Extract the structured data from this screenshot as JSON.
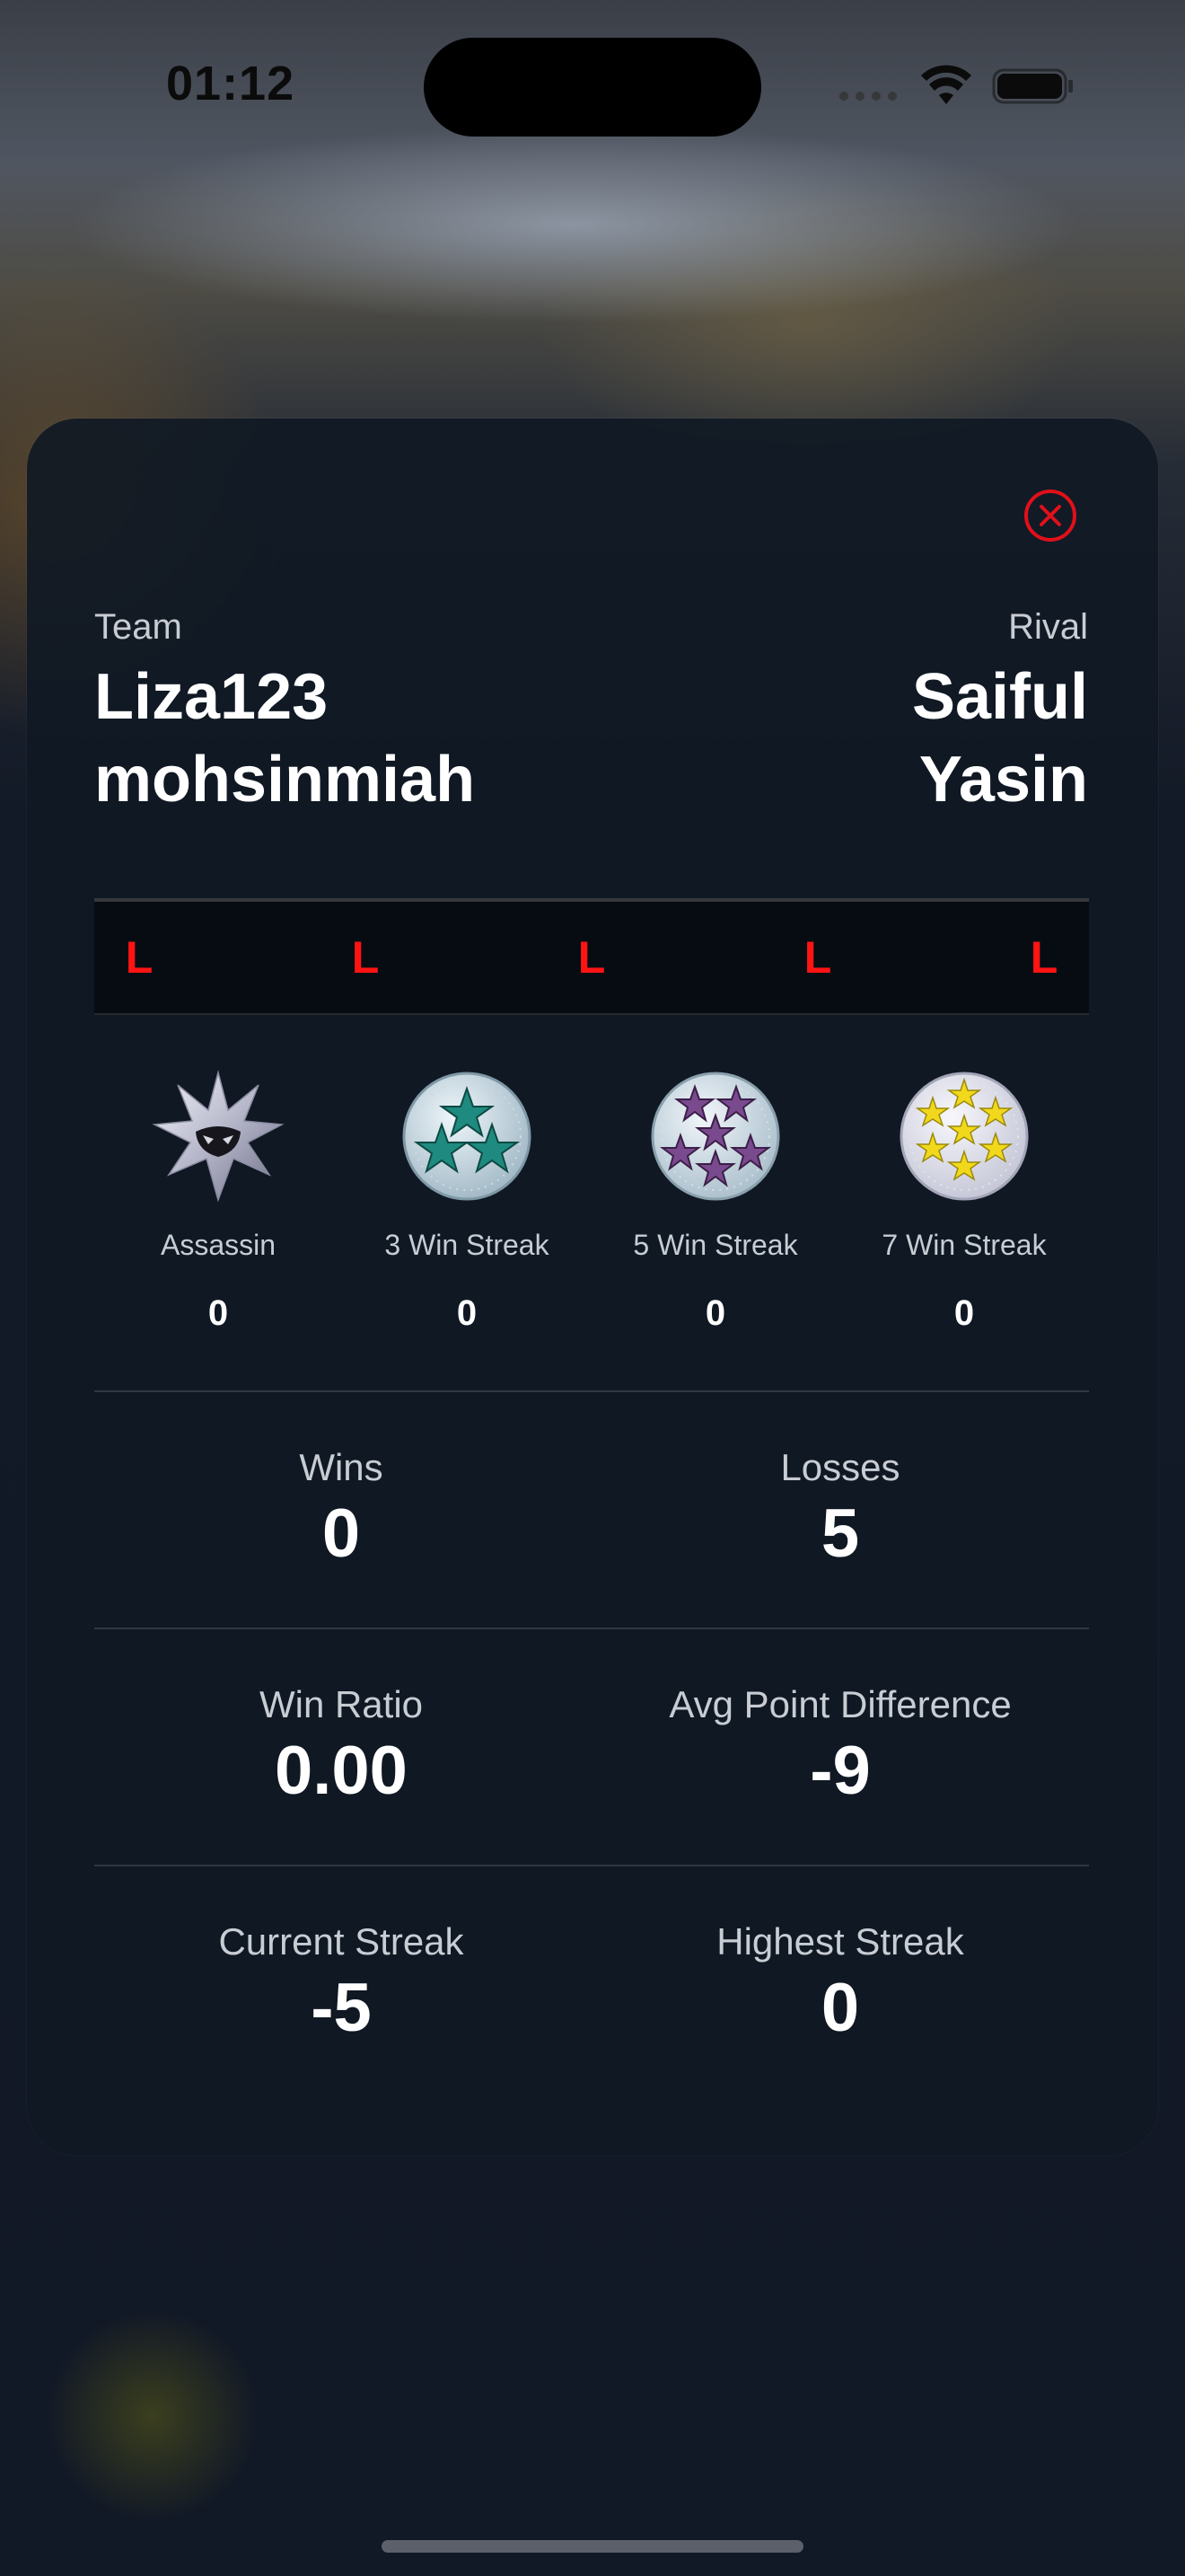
{
  "status_bar": {
    "time": "01:12"
  },
  "sheet": {
    "team_label": "Team",
    "team_names": [
      "Liza123",
      "mohsinmiah"
    ],
    "rival_label": "Rival",
    "rival_names": [
      "Saiful",
      "Yasin"
    ]
  },
  "recent_results": [
    "L",
    "L",
    "L",
    "L",
    "L"
  ],
  "badges": [
    {
      "label": "Assassin",
      "count": "0",
      "icon": "assassin-star-icon"
    },
    {
      "label": "3 Win Streak",
      "count": "0",
      "icon": "three-star-medal-icon"
    },
    {
      "label": "5 Win Streak",
      "count": "0",
      "icon": "five-star-medal-icon"
    },
    {
      "label": "7 Win Streak",
      "count": "0",
      "icon": "seven-star-medal-icon"
    }
  ],
  "stats": {
    "wins": {
      "label": "Wins",
      "value": "0"
    },
    "losses": {
      "label": "Losses",
      "value": "5"
    },
    "win_ratio": {
      "label": "Win Ratio",
      "value": "0.00"
    },
    "avg_point_difference": {
      "label": "Avg Point Difference",
      "value": "-9"
    },
    "current_streak": {
      "label": "Current Streak",
      "value": "-5"
    },
    "highest_streak": {
      "label": "Highest Streak",
      "value": "0"
    }
  },
  "colors": {
    "loss_red": "#ff1414",
    "close_red": "#e0101a",
    "sheet_bg": "#101824",
    "teal_star": "#1f8a7f",
    "purple_star": "#7a4a8f",
    "yellow_star": "#f2d81c"
  }
}
